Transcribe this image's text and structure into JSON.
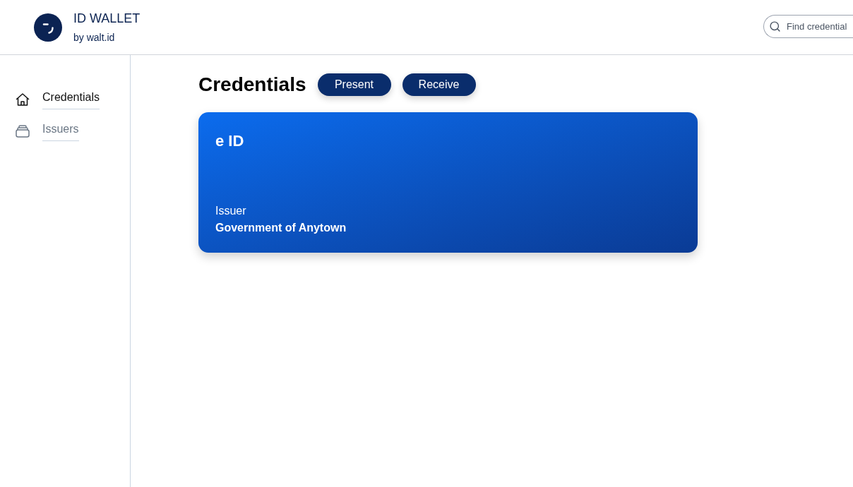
{
  "header": {
    "title": "ID WALLET",
    "subtitle": "by walt.id",
    "search": {
      "placeholder": "Find credential"
    }
  },
  "sidebar": {
    "items": [
      {
        "label": "Credentials",
        "selected": true
      },
      {
        "label": "Issuers",
        "selected": false
      }
    ]
  },
  "main": {
    "title": "Credentials",
    "actions": [
      "Present",
      "Receive"
    ],
    "credentials": [
      {
        "title": "e ID",
        "issuer_label": "Issuer",
        "issuer": "Government of Anytown"
      }
    ]
  }
}
